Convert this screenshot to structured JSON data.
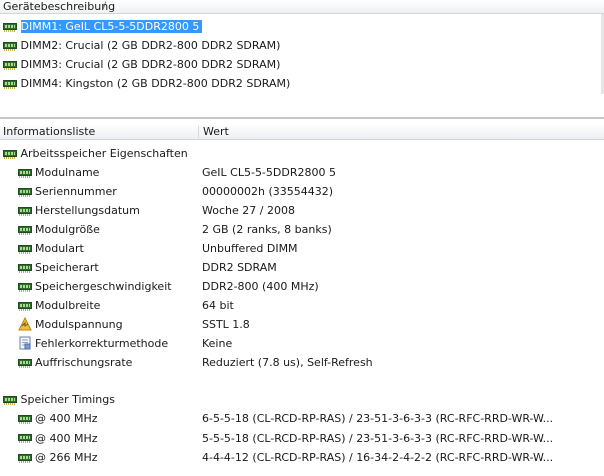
{
  "top_panel": {
    "header": "Gerätebeschreibung",
    "devices": [
      "DIMM1: GeIL CL5-5-5DDR2800 5",
      "DIMM2: Crucial (2 GB DDR2-800 DDR2 SDRAM)",
      "DIMM3: Crucial (2 GB DDR2-800 DDR2 SDRAM)",
      "DIMM4: Kingston (2 GB DDR2-800 DDR2 SDRAM)"
    ]
  },
  "bottom_panel": {
    "col_field": "Informationsliste",
    "col_value": "Wert",
    "group1": {
      "title": "Arbeitsspeicher Eigenschaften",
      "rows": [
        {
          "icon": "ram-module-icon",
          "field": "Modulname",
          "value": "GeIL CL5-5-5DDR2800 5"
        },
        {
          "icon": "ram-module-icon",
          "field": "Seriennummer",
          "value": "00000002h (33554432)"
        },
        {
          "icon": "ram-module-icon",
          "field": "Herstellungsdatum",
          "value": "Woche 27 / 2008"
        },
        {
          "icon": "ram-module-icon",
          "field": "Modulgröße",
          "value": "2 GB (2 ranks, 8 banks)"
        },
        {
          "icon": "ram-module-icon",
          "field": "Modulart",
          "value": "Unbuffered DIMM"
        },
        {
          "icon": "ram-module-icon",
          "field": "Speicherart",
          "value": "DDR2 SDRAM"
        },
        {
          "icon": "ram-module-icon",
          "field": "Speichergeschwindigkeit",
          "value": "DDR2-800 (400 MHz)"
        },
        {
          "icon": "ram-module-icon",
          "field": "Modulbreite",
          "value": "64 bit"
        },
        {
          "icon": "voltage-warning-icon",
          "field": "Modulspannung",
          "value": "SSTL 1.8"
        },
        {
          "icon": "error-correction-icon",
          "field": "Fehlerkorrekturmethode",
          "value": "Keine"
        },
        {
          "icon": "ram-module-icon",
          "field": "Auffrischungsrate",
          "value": "Reduziert (7.8 us), Self-Refresh"
        }
      ]
    },
    "group2": {
      "title": "Speicher Timings",
      "rows": [
        {
          "field": "@ 400 MHz",
          "value": "6-5-5-18  (CL-RCD-RP-RAS) / 23-51-3-6-3-3  (RC-RFC-RRD-WR-W..."
        },
        {
          "field": "@ 400 MHz",
          "value": "5-5-5-18  (CL-RCD-RP-RAS) / 23-51-3-6-3-3  (RC-RFC-RRD-WR-W..."
        },
        {
          "field": "@ 266 MHz",
          "value": "4-4-4-12  (CL-RCD-RP-RAS) / 16-34-2-4-2-2  (RC-RFC-RRD-WR-W..."
        }
      ]
    }
  }
}
